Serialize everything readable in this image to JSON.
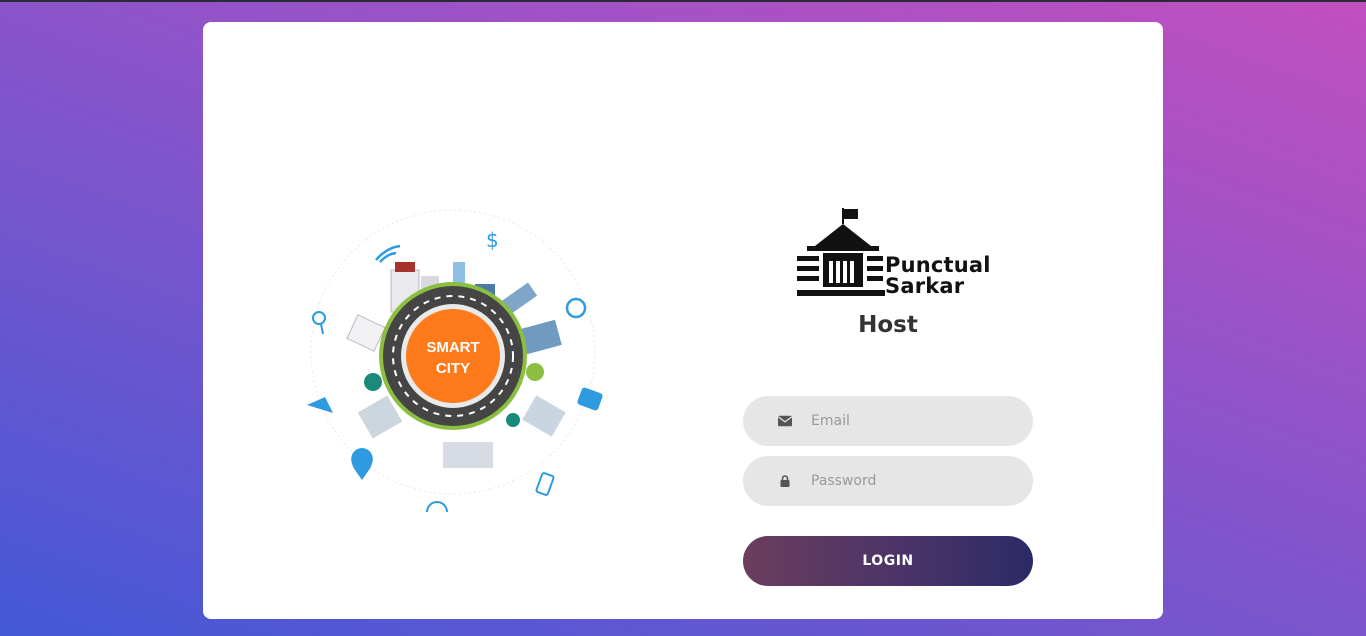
{
  "illustration": {
    "badge_line1": "SMART",
    "badge_line2": "CITY",
    "badge_color": "#ff7a1a"
  },
  "logo": {
    "line1": "Punctual",
    "line2": "Sarkar"
  },
  "title": "Host",
  "form": {
    "email_placeholder": "Email",
    "password_placeholder": "Password",
    "email_icon": "envelope-icon",
    "password_icon": "lock-icon",
    "login_label": "LOGIN"
  },
  "colors": {
    "accent_start": "#6c3d5e",
    "accent_end": "#2c2a66",
    "field_bg": "#e6e6e6"
  }
}
